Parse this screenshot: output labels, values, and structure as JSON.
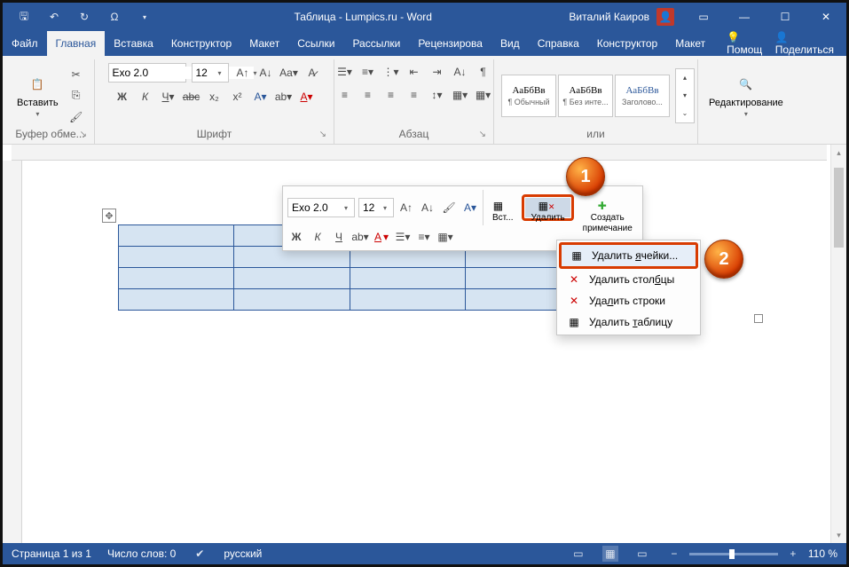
{
  "title": "Таблица - Lumpics.ru  -  Word",
  "user": "Виталий Каиров",
  "tabs": [
    "Файл",
    "Главная",
    "Вставка",
    "Конструктор",
    "Макет",
    "Ссылки",
    "Рассылки",
    "Рецензирова",
    "Вид",
    "Справка",
    "Конструктор",
    "Макет"
  ],
  "active_tab": "Главная",
  "help_placeholder": "Помощ",
  "share": "Поделиться",
  "ribbon": {
    "clipboard": {
      "paste": "Вставить",
      "label": "Буфер обме..."
    },
    "font": {
      "name": "Exo 2.0",
      "size": "12",
      "label": "Шрифт"
    },
    "paragraph": {
      "label": "Абзац"
    },
    "styles": {
      "label": "или",
      "items": [
        {
          "sample": "АаБбВв",
          "name": "¶ Обычный"
        },
        {
          "sample": "АаБбВв",
          "name": "¶ Без инте..."
        },
        {
          "sample": "АаБбВв",
          "name": "Заголово..."
        }
      ]
    },
    "editing": {
      "label": "Редактирование"
    }
  },
  "mini": {
    "font": "Exo 2.0",
    "size": "12",
    "insert": "Вст...",
    "delete": "Удалить",
    "comment": {
      "l1": "Создать",
      "l2": "примечание"
    }
  },
  "menu": {
    "cells": "Удалить ячейки...",
    "cols": "Удалить столбцы",
    "rows": "Удалить строки",
    "table": "Удалить таблицу"
  },
  "callouts": {
    "one": "1",
    "two": "2"
  },
  "status": {
    "page": "Страница 1 из 1",
    "words": "Число слов: 0",
    "lang": "русский",
    "zoom": "110 %"
  }
}
